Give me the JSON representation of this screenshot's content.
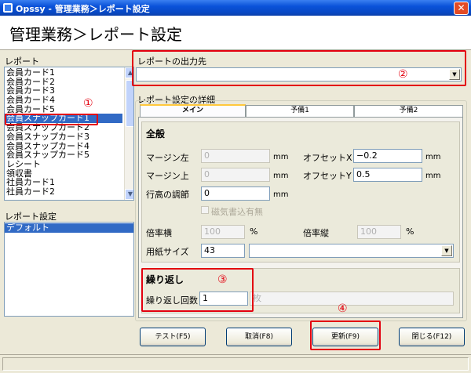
{
  "window": {
    "title": "Opssy - 管理業務＞レポート設定",
    "close_glyph": "✕"
  },
  "header": {
    "title": "管理業務＞レポート設定"
  },
  "report_list": {
    "label": "レポート",
    "items": [
      "会員カード1",
      "会員カード2",
      "会員カード3",
      "会員カード4",
      "会員カード5",
      "会員スナップカード1",
      "会員スナップカード2",
      "会員スナップカード3",
      "会員スナップカード4",
      "会員スナップカード5",
      "レシート",
      "領収書",
      "社員カード1",
      "社員カード2"
    ],
    "selected_index": 5
  },
  "settings_list": {
    "label": "レポート設定",
    "items": [
      "デフォルト"
    ],
    "selected_index": 0
  },
  "output": {
    "label": "レポートの出力先",
    "value": ""
  },
  "details": {
    "label": "レポート設定の詳細"
  },
  "tabs": [
    {
      "label": "メイン"
    },
    {
      "label": "予備1"
    },
    {
      "label": "予備2"
    }
  ],
  "general": {
    "title": "全般",
    "margin_left_label": "マージン左",
    "margin_left_value": "0",
    "margin_top_label": "マージン上",
    "margin_top_value": "0",
    "line_height_label": "行高の調節",
    "line_height_value": "0",
    "unit": "mm",
    "offset_x_label": "オフセットX",
    "offset_x_value": "−0.2",
    "offset_y_label": "オフセットY",
    "offset_y_value": "0.5",
    "magnetic_label": "磁気書込有無",
    "scale_h_label": "倍率横",
    "scale_h_value": "100",
    "scale_v_label": "倍率縦",
    "scale_v_value": "100",
    "percent": "%",
    "paper_label": "用紙サイズ",
    "paper_value": "43",
    "paper_name": ""
  },
  "repeat": {
    "title": "繰り返し",
    "count_label": "繰り返し回数",
    "count_value": "1",
    "unit": "枚"
  },
  "buttons": {
    "test": "テスト(F5)",
    "cancel": "取消(F8)",
    "update": "更新(F9)",
    "close": "閉じる(F12)"
  },
  "callouts": [
    "①",
    "②",
    "③",
    "④"
  ],
  "colors": {
    "titlebar": "#0a52d9",
    "selection": "#316ac5",
    "callout": "#e3000f"
  }
}
